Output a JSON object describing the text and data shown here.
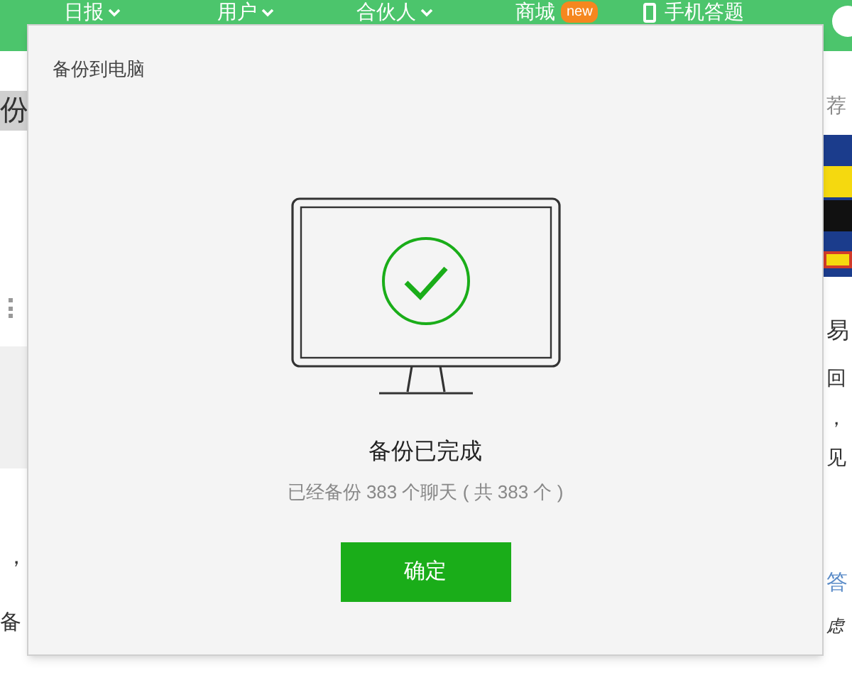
{
  "nav": {
    "items": [
      {
        "label": "日报",
        "dropdown": true
      },
      {
        "label": "用户",
        "dropdown": true
      },
      {
        "label": "合伙人",
        "dropdown": true
      },
      {
        "label": "商城",
        "dropdown": false,
        "badge": "new"
      },
      {
        "label": "手机答题",
        "dropdown": false
      }
    ]
  },
  "background": {
    "left": [
      "份",
      "，",
      "备"
    ],
    "right": [
      "荐",
      "易",
      "回",
      "，",
      "见",
      "答",
      "虑"
    ]
  },
  "dialog": {
    "title": "备份到电脑",
    "status": "备份已完成",
    "detail": "已经备份 383 个聊天 ( 共 383 个 )",
    "button": "确定"
  }
}
